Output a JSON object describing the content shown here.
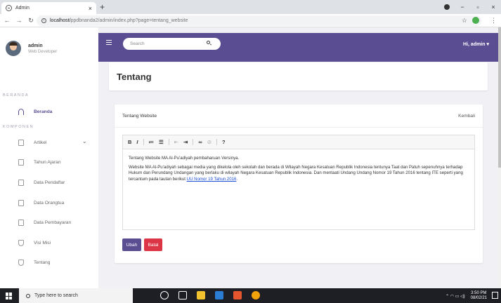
{
  "browser": {
    "tab_title": "Admin",
    "tab_close": "×",
    "new_tab": "+",
    "url_host": "localhost/",
    "url_path": "ppdbnanda2/admin/index.php?page=tentang_website",
    "window_controls": [
      "−",
      "▫",
      "×"
    ]
  },
  "sidebar": {
    "user_name": "admin",
    "user_role": "Web Developer",
    "section_beranda": "BERANDA",
    "section_komponen": "KOMPONEN",
    "items": [
      {
        "label": "Beranda",
        "icon": "dashboard-icon"
      },
      {
        "label": "Artikel",
        "icon": "folder-icon"
      },
      {
        "label": "Tahun Ajaran",
        "icon": "clipboard-icon"
      },
      {
        "label": "Data Pendaftar",
        "icon": "clipboard-icon"
      },
      {
        "label": "Data Orangtua",
        "icon": "clipboard-icon"
      },
      {
        "label": "Data Pembayaran",
        "icon": "clipboard-icon"
      },
      {
        "label": "Visi Misi",
        "icon": "shield-icon"
      },
      {
        "label": "Tentang",
        "icon": "shield-icon"
      }
    ]
  },
  "header": {
    "search_placeholder": "Search",
    "user_menu": "Hi, admin ▾"
  },
  "page": {
    "title": "Tentang"
  },
  "card": {
    "heading": "Tentang Website",
    "back_link": "Kembali",
    "toolbar": [
      "B",
      "I",
      "?"
    ],
    "content_p1": "Tentang Website MA Al-Pu'adiyah pembaharuan Versinya.",
    "content_p2": "Website MA Al-Pu'adiyah sebagai media yang dikelola oleh sekolah dan berada di Wilayah Negara Kesatuan Republik Indonesia tentunya Taat dan Patuh sepenuhnya terhadap Hukum dan Perundang Undangan yang berlaku di wilayah Negara Kesatuan Republik Indonesia. Dan mentaati Undang Undang Nomor 19 Tahun 2016 tentang ITE seperti yang tercantum pada tautan berikut",
    "content_link": "UU Nomor 19 Tahun 2016",
    "content_end": ".",
    "btn_save": "Ubah",
    "btn_cancel": "Batal"
  },
  "taskbar": {
    "search_text": "Type here to search",
    "time": "3:50 PM",
    "date": "08/02/21",
    "app_colors": [
      "#ffffff",
      "#ffffff",
      "#f2c12e",
      "#2b7cd3",
      "#e4572e",
      "#f0a30a"
    ]
  },
  "colors": {
    "primary": "#5a4d92",
    "danger": "#dc3545",
    "link": "#1a4fd6"
  }
}
